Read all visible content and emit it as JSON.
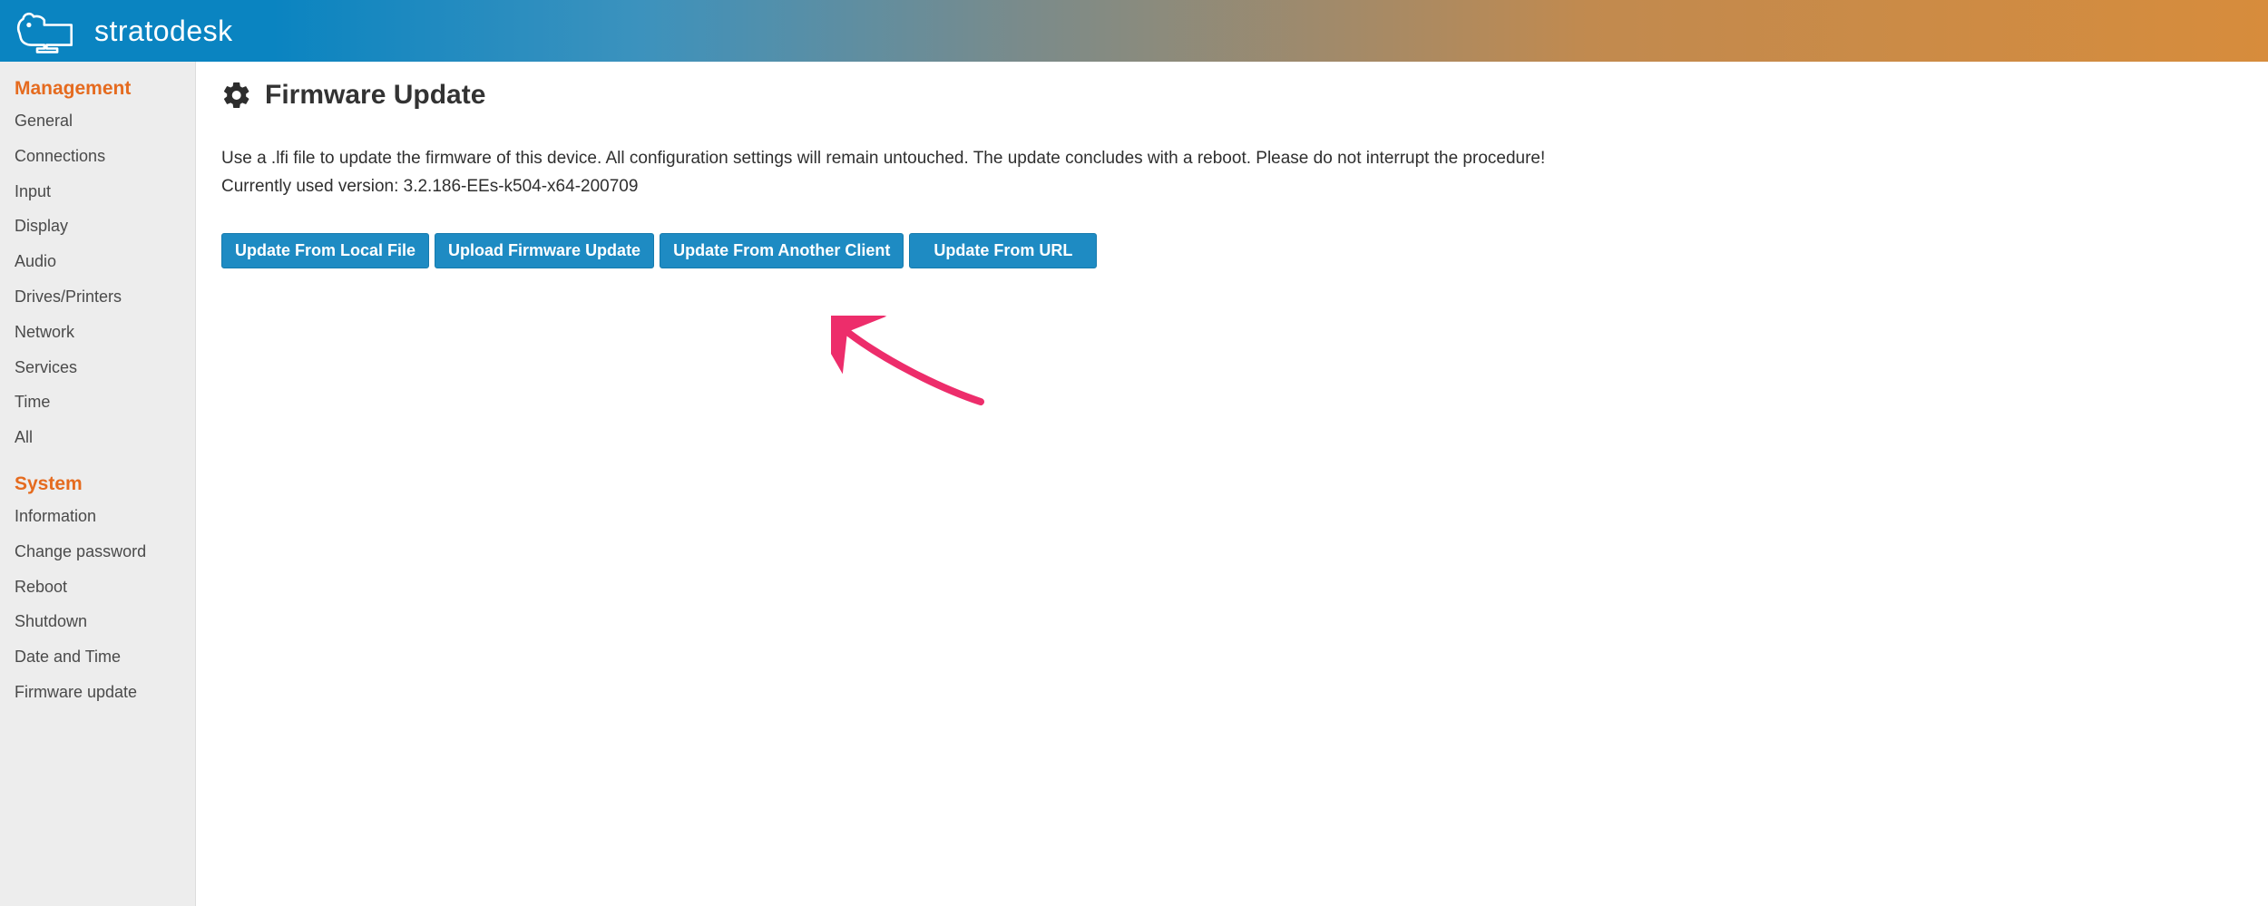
{
  "brand": {
    "name": "stratodesk"
  },
  "sidebar": {
    "groups": [
      {
        "heading": "Management",
        "items": [
          "General",
          "Connections",
          "Input",
          "Display",
          "Audio",
          "Drives/Printers",
          "Network",
          "Services",
          "Time",
          "All"
        ]
      },
      {
        "heading": "System",
        "items": [
          "Information",
          "Change password",
          "Reboot",
          "Shutdown",
          "Date and Time",
          "Firmware update"
        ]
      }
    ]
  },
  "page": {
    "title": "Firmware Update",
    "description": "Use a .lfi file to update the firmware of this device. All configuration settings will remain untouched. The update concludes with a reboot. Please do not interrupt the procedure!",
    "version_label": "Currently used version: 3.2.186-EEs-k504-x64-200709",
    "buttons": {
      "local_file": "Update From Local File",
      "upload": "Upload Firmware Update",
      "another_client": "Update From Another Client",
      "from_url": "Update From URL"
    }
  }
}
